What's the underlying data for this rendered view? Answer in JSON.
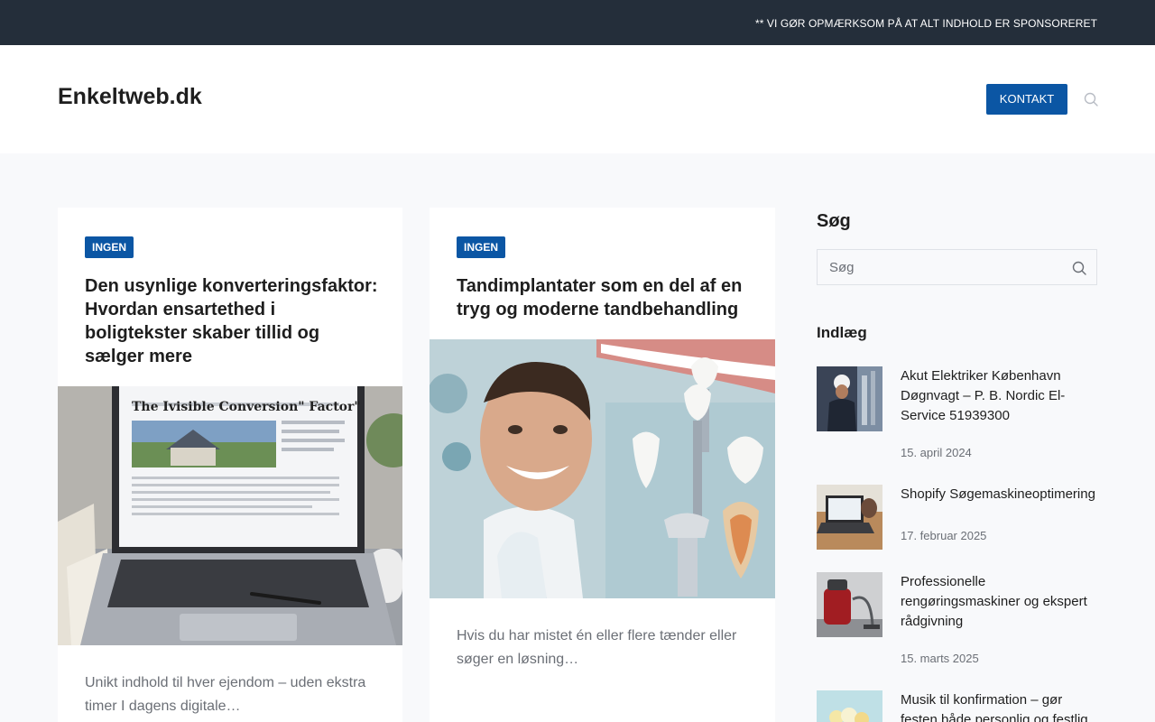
{
  "topbar": {
    "notice": "** VI GØR OPMÆRKSOM PÅ AT ALT INDHOLD ER SPONSORERET"
  },
  "header": {
    "site_title": "Enkeltweb.dk",
    "contact_label": "KONTAKT"
  },
  "articles": [
    {
      "category": "INGEN",
      "title": "Den usynlige konverteringsfaktor: Hvordan ensartethed i boligtekster skaber tillid og sælger mere",
      "image_caption": "The Ivisible Conversion\" Factor\"",
      "excerpt": "Unikt indhold til hver ejendom – uden ekstra timer I dagens digitale…"
    },
    {
      "category": "INGEN",
      "title": "Tandimplantater som en del af en tryg og moderne tandbehandling",
      "excerpt": "Hvis du har mistet én eller flere tænder eller søger en løsning…"
    }
  ],
  "sidebar": {
    "search_title": "Søg",
    "search_placeholder": "Søg",
    "posts_title": "Indlæg",
    "posts": [
      {
        "title": "Akut Elektriker København Døgnvagt – P. B. Nordic El-Service 51939300",
        "date": "15. april 2024"
      },
      {
        "title": "Shopify Søgemaskineoptimering",
        "date": "17. februar 2025"
      },
      {
        "title": "Professionelle rengøringsmaskiner og ekspert rådgivning",
        "date": "15. marts 2025"
      },
      {
        "title": "Musik til konfirmation – gør festen både personlig og festlig",
        "date": ""
      }
    ]
  },
  "colors": {
    "topbar": "#242e3a",
    "accent": "#0b56a4",
    "background": "#f8f9fb"
  }
}
